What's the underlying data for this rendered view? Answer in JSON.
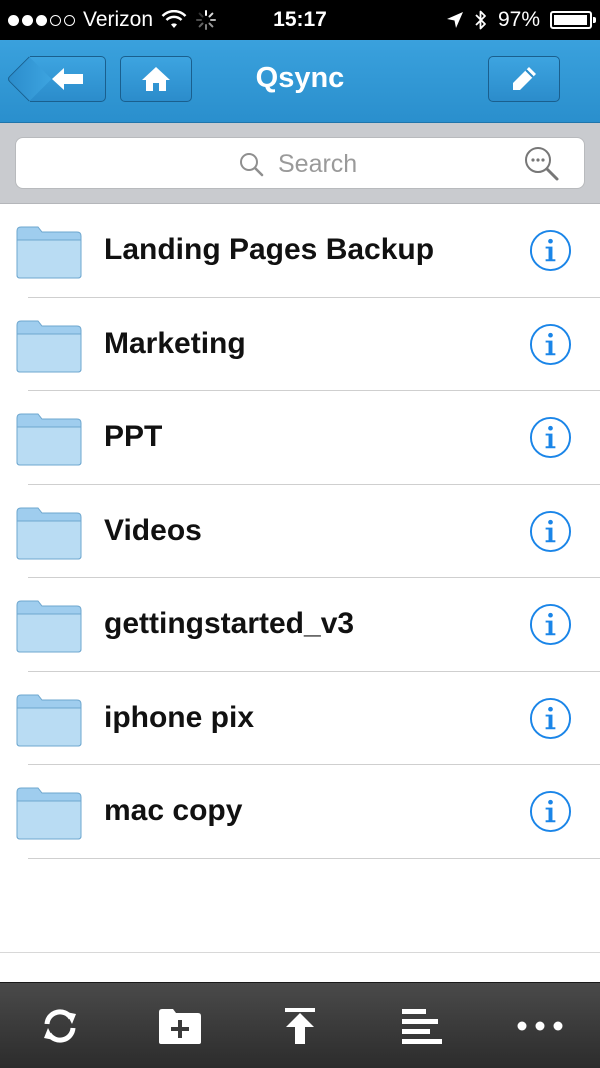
{
  "status_bar": {
    "carrier": "Verizon",
    "signal_bars_filled": 3,
    "signal_bars_total": 5,
    "time": "15:17",
    "battery": "97%",
    "battery_level": 0.97
  },
  "nav": {
    "title": "Qsync",
    "back_icon": "arrow-left-icon",
    "home_icon": "home-icon",
    "edit_icon": "pencil-icon"
  },
  "search": {
    "placeholder": "Search",
    "icon": "search-icon",
    "advanced_icon": "search-more-icon"
  },
  "files": [
    {
      "name": "Landing Pages Backup",
      "type": "folder"
    },
    {
      "name": "Marketing",
      "type": "folder"
    },
    {
      "name": "PPT",
      "type": "folder"
    },
    {
      "name": "Videos",
      "type": "folder"
    },
    {
      "name": "gettingstarted_v3",
      "type": "folder"
    },
    {
      "name": "iphone pix",
      "type": "folder"
    },
    {
      "name": "mac copy",
      "type": "folder"
    }
  ],
  "toolbar": {
    "items": [
      {
        "icon": "refresh-icon"
      },
      {
        "icon": "new-folder-icon"
      },
      {
        "icon": "upload-icon"
      },
      {
        "icon": "sort-icon"
      },
      {
        "icon": "more-icon"
      }
    ]
  },
  "colors": {
    "nav_blue": "#2a8fcd",
    "info_blue": "#1a85e8",
    "folder_blue": "#b9dcf3"
  }
}
